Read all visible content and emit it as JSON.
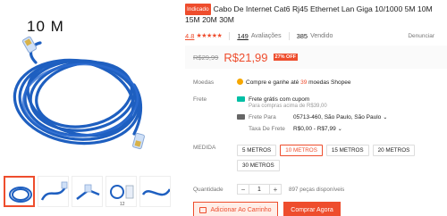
{
  "gallery": {
    "main_tag": "10 M",
    "thumb_icons": [
      "cable-coil-thumb",
      "cable-end-thumb",
      "connector-thumb",
      "cable-pack-thumb",
      "cable-alt-thumb"
    ]
  },
  "product": {
    "badge": "Indicado",
    "title": "Cabo De Internet Cat6 Rj45 Ethernet Lan Giga 10/1000 5M 10M 15M 20M 30M"
  },
  "rating": {
    "score": "4.8",
    "stars": "★★★★★",
    "reviews_count": "149",
    "reviews_label": "Avaliações",
    "sold_count": "385",
    "sold_label": "Vendido",
    "report_label": "Denunciar"
  },
  "price": {
    "old": "R$29,99",
    "new": "R$21,99",
    "discount": "27% OFF"
  },
  "coins": {
    "label": "Moedas",
    "text_before": "Compre e ganhe até",
    "amount": "39",
    "text_after": "moedas Shopee"
  },
  "shipping": {
    "label": "Frete",
    "free_title": "Frete grátis com cupom",
    "free_sub": "Para compras acima de R$39,00",
    "to_label": "Frete Para",
    "to_value": "05713-460, São Paulo, São Paulo",
    "fee_label": "Taxa De Frete",
    "fee_value": "R$0,00 - R$7,99"
  },
  "variation": {
    "label": "MEDIDA",
    "options": [
      "5 METROS",
      "10 METROS",
      "15 METROS",
      "20 METROS",
      "30 METROS"
    ],
    "selected_index": 1
  },
  "quantity": {
    "label": "Quantidade",
    "value": "1",
    "minus": "−",
    "plus": "+",
    "available": "897 peças disponíveis"
  },
  "actions": {
    "add_to_cart": "Adicionar Ao Carrinho",
    "buy_now": "Comprar Agora"
  },
  "colors": {
    "accent": "#ee4d2d",
    "cable_blue": "#1e5fc0"
  }
}
